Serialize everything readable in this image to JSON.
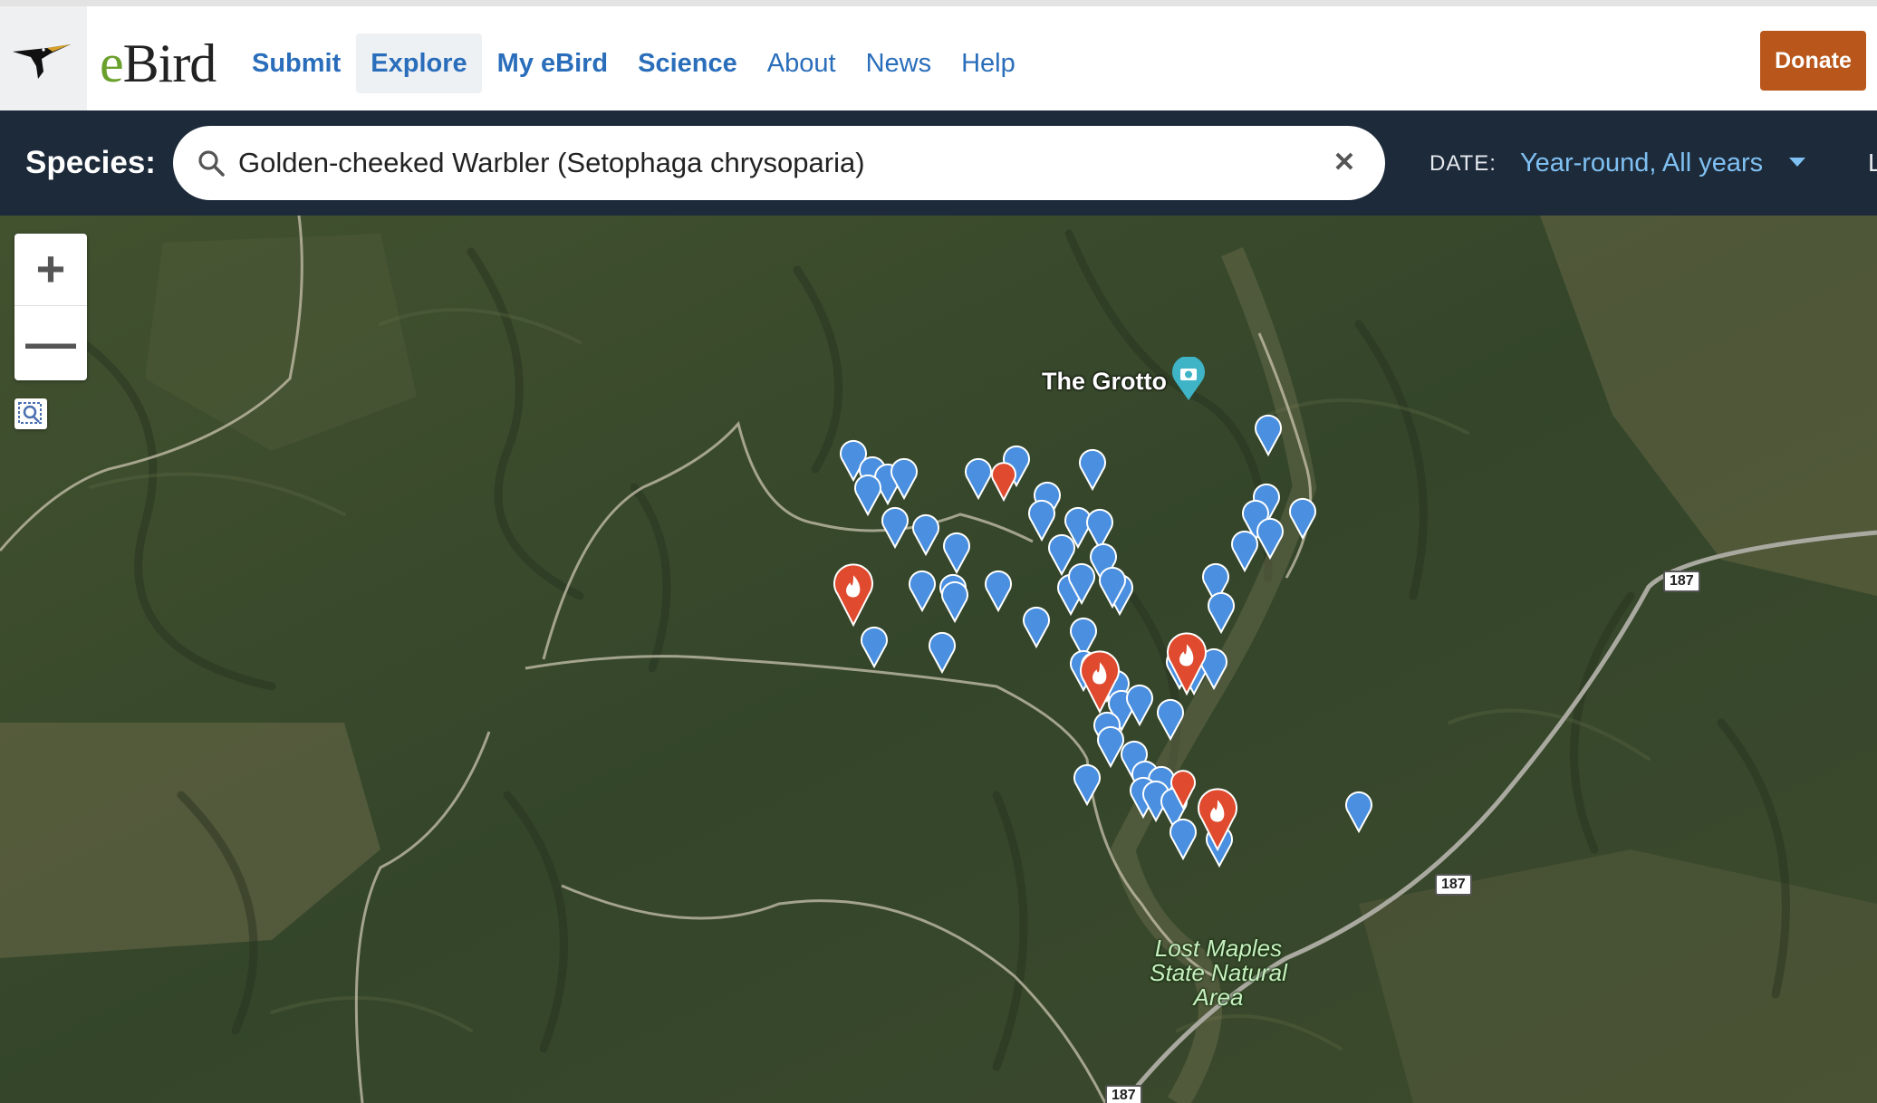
{
  "nav": {
    "logo_e": "e",
    "logo_rest": "Bird",
    "items": [
      {
        "label": "Submit"
      },
      {
        "label": "Explore"
      },
      {
        "label": "My eBird"
      },
      {
        "label": "Science"
      },
      {
        "label": "About"
      },
      {
        "label": "News"
      },
      {
        "label": "Help"
      }
    ],
    "donate_label": "Donate"
  },
  "species_bar": {
    "label": "Species:",
    "value": "Golden-cheeked Warbler (Setophaga chrysoparia)",
    "date_label": "DATE:",
    "date_value": "Year-round,  All years",
    "clipped_next_label": "L"
  },
  "map": {
    "zoom_in": "+",
    "zoom_out": "—",
    "poi_label": "The Grotto",
    "park_label_line1": "Lost Maples",
    "park_label_line2": "State Natural",
    "park_label_line3": "Area",
    "route_label": "187",
    "colors": {
      "marker_blue": "#4a8fe0",
      "marker_red": "#e04a2e",
      "terrain": "#3b4a30"
    }
  }
}
